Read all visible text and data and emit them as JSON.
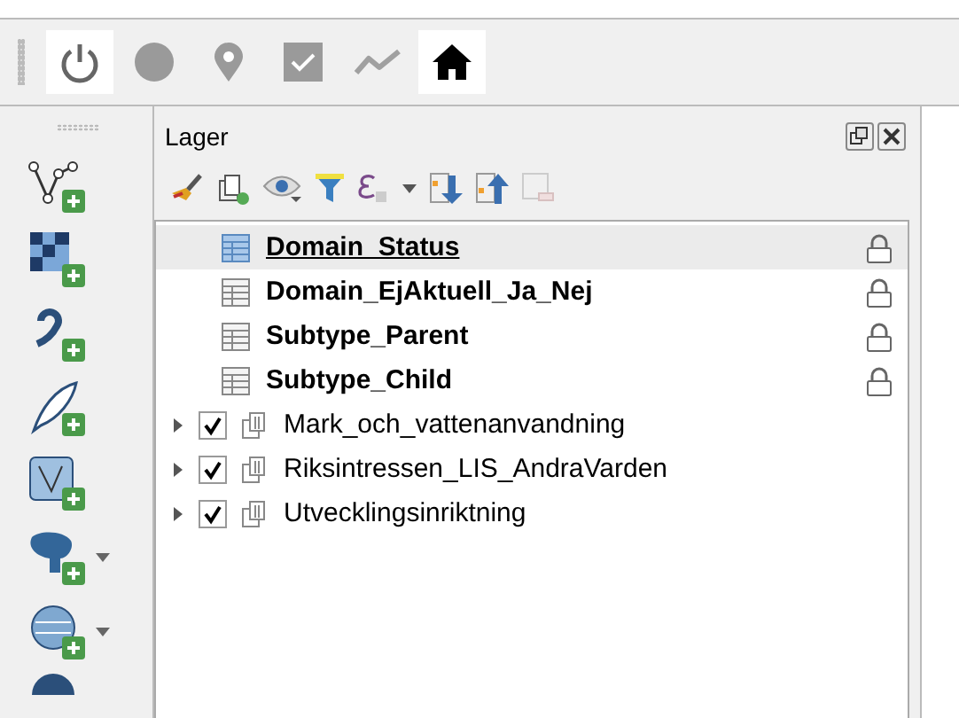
{
  "panel": {
    "title": "Lager"
  },
  "layers": [
    {
      "label": "Domain_Status",
      "kind": "table",
      "selected": true
    },
    {
      "label": "Domain_EjAktuell_Ja_Nej",
      "kind": "table",
      "selected": false
    },
    {
      "label": "Subtype_Parent",
      "kind": "table",
      "selected": false
    },
    {
      "label": "Subtype_Child",
      "kind": "table",
      "selected": false
    },
    {
      "label": "Mark_och_vattenanvandning",
      "kind": "group",
      "selected": false,
      "checked": true,
      "expanded": false
    },
    {
      "label": "Riksintressen_LIS_AndraVarden",
      "kind": "group",
      "selected": false,
      "checked": true,
      "expanded": false
    },
    {
      "label": "Utvecklingsinriktning",
      "kind": "group",
      "selected": false,
      "checked": true,
      "expanded": false
    }
  ]
}
